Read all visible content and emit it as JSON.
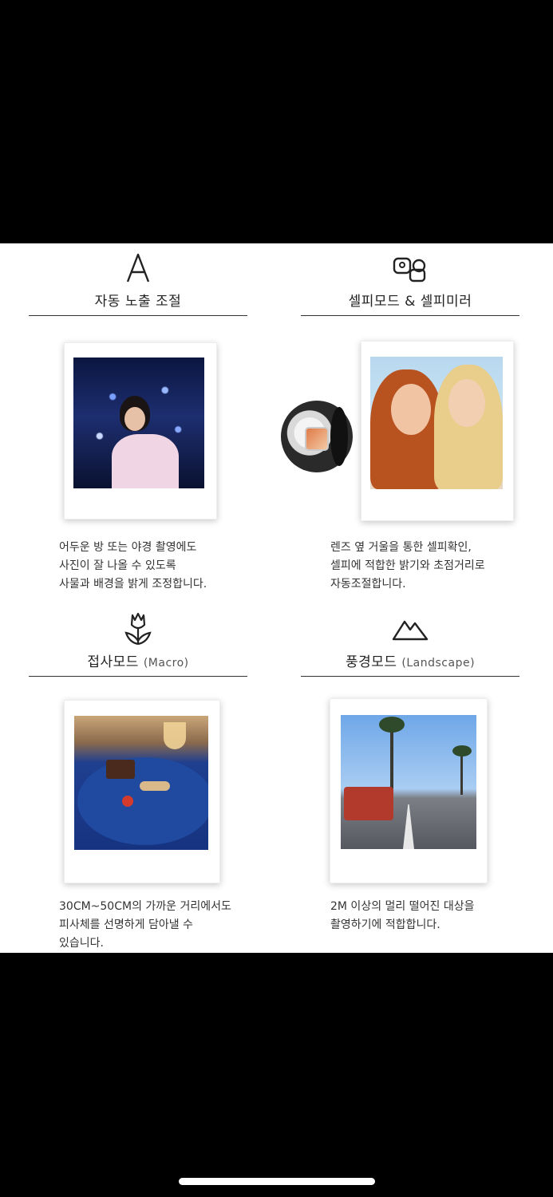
{
  "features": [
    {
      "icon": "letter-a-icon",
      "icon_text": "A",
      "title": "자동 노출 조절",
      "subtitle": "",
      "description": [
        "어두운 방 또는 야경 촬영에도",
        "사진이 잘 나올 수 있도록",
        "사물과 배경을 밝게 조정합니다."
      ]
    },
    {
      "icon": "selfie-mirror-icon",
      "title": "셀피모드 & 셀피미러",
      "subtitle": "",
      "description": [
        "렌즈 옆 거울을 통한 셀피확인,",
        "셀피에 적합한 밝기와 초점거리로",
        "자동조절합니다."
      ]
    },
    {
      "icon": "tulip-icon",
      "title": "접사모드",
      "subtitle": "(Macro)",
      "description": [
        "30CM~50CM의 가까운 거리에서도",
        "피사체를 선명하게 담아낼 수",
        "있습니다."
      ]
    },
    {
      "icon": "mountain-icon",
      "title": "풍경모드",
      "subtitle": "(Landscape)",
      "description": [
        "2M 이상의 멀리 떨어진 대상을",
        "촬영하기에 적합합니다."
      ]
    }
  ],
  "colors": {
    "background": "#000000",
    "panel": "#ffffff",
    "text": "#222222"
  }
}
